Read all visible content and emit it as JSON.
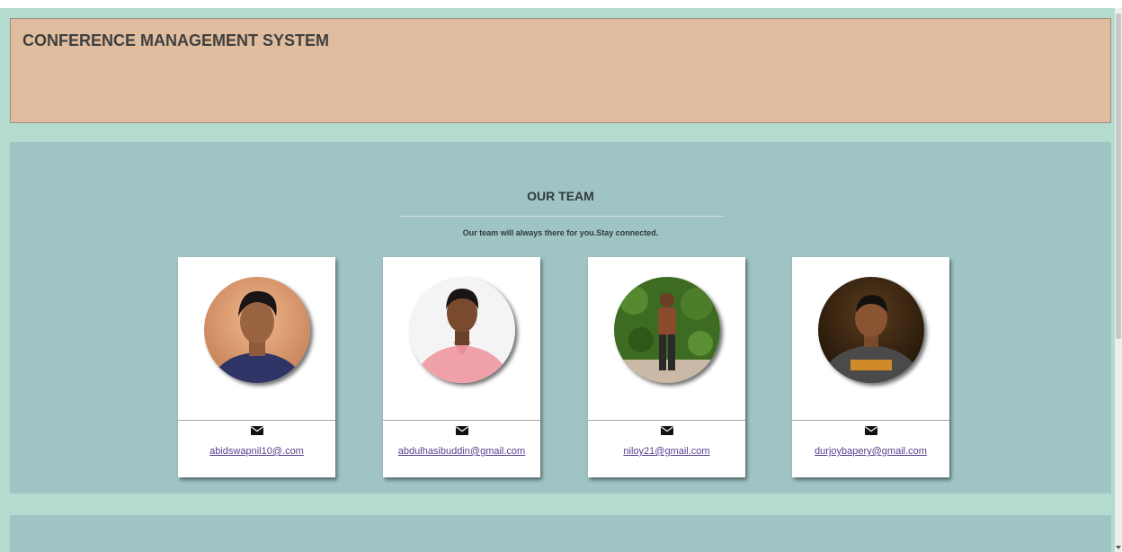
{
  "header": {
    "title": "CONFERENCE MANAGEMENT SYSTEM"
  },
  "team": {
    "title": "OUR TEAM",
    "subtitle": "Our team will always there for you.Stay connected.",
    "members": [
      {
        "email": "abidswapnil10@.com",
        "icon": "envelope-icon"
      },
      {
        "email": "abdulhasibuddin@gmail.com",
        "icon": "envelope-icon"
      },
      {
        "email": "niloy21@gmail.com",
        "icon": "envelope-icon"
      },
      {
        "email": "durjoybapery@gmail.com",
        "icon": "envelope-icon"
      }
    ]
  },
  "colors": {
    "page_background": "#b3dccf",
    "header_background": "#e0bd9f",
    "section_background": "#a0c4c4",
    "card_background": "#ffffff",
    "link_color": "#5a3d8e"
  }
}
